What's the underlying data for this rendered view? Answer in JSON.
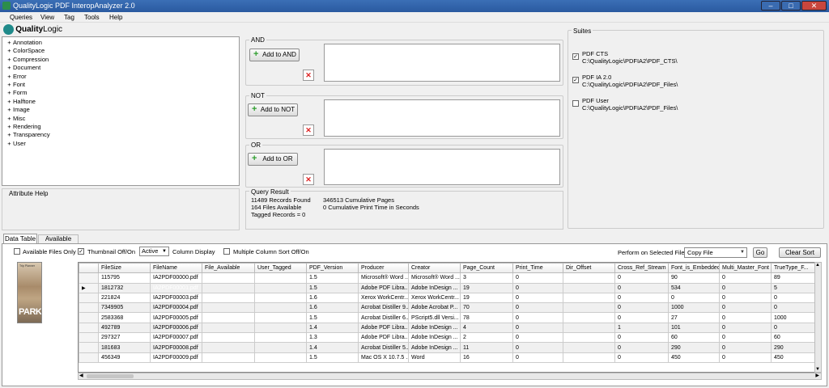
{
  "window": {
    "title": "QualityLogic PDF InteropAnalyzer 2.0",
    "min": "–",
    "max": "□",
    "close": "✕"
  },
  "menu": [
    "Queries",
    "View",
    "Tag",
    "Tools",
    "Help"
  ],
  "logo": {
    "text1": "Quality",
    "text2": "Logic"
  },
  "tree": [
    "Annotation",
    "ColorSpace",
    "Compression",
    "Document",
    "Error",
    "Font",
    "Form",
    "Halftone",
    "Image",
    "Misc",
    "Rendering",
    "Transparency",
    "User"
  ],
  "query": {
    "and": {
      "title": "AND",
      "button": "Add to AND"
    },
    "not": {
      "title": "NOT",
      "button": "Add to NOT"
    },
    "or": {
      "title": "OR",
      "button": "Add to OR"
    }
  },
  "suites": {
    "title": "Suites",
    "items": [
      {
        "name": "PDF CTS",
        "path": "C:\\QualityLogic\\PDFIA2\\PDF_CTS\\",
        "checked": true
      },
      {
        "name": "PDF IA 2.0",
        "path": "C:\\QualityLogic\\PDFIA2\\PDF_Files\\",
        "checked": true
      },
      {
        "name": "PDF User",
        "path": "C:\\QualityLogic\\PDFIA2\\PDF_Files\\",
        "checked": false
      }
    ]
  },
  "attribute_help": {
    "title": "Attribute Help"
  },
  "query_result": {
    "title": "Query Result",
    "records": "11489 Records Found",
    "files": "164 Files Available",
    "tagged": "Tagged Records = 0",
    "pages": "346513 Cumulative Pages",
    "print_time": "0 Cumulative Print Time in Seconds"
  },
  "tabs": [
    "Data Table",
    "Available Files"
  ],
  "toolbar": {
    "available_only": "Available Files Only",
    "thumbnail": "Thumbnail Off/On",
    "active": "Active",
    "column_display": "Column Display",
    "multi_sort": "Multiple Column Sort Off/On",
    "perform_label": "Perform on Selected File:",
    "action": "Copy File",
    "go": "Go",
    "clear_sort": "Clear Sort"
  },
  "thumb": {
    "small": "Trip Planner",
    "big": "PARK"
  },
  "table": {
    "columns": [
      "FileSize",
      "FileName",
      "File_Available",
      "User_Tagged",
      "PDF_Version",
      "Producer",
      "Creator",
      "Page_Count",
      "Print_Time",
      "Dir_Offset",
      "Cross_Ref_Stream",
      "Font_is_Embedded",
      "Multi_Master_Font",
      "TrueType_F..."
    ],
    "rows": [
      [
        "115795",
        "IA2PDF00000.pdf",
        "",
        "",
        "1.5",
        "Microsoft® Word ...",
        "Microsoft® Word ...",
        "3",
        "0",
        "",
        "0",
        "90",
        "0",
        "89"
      ],
      [
        "1812732",
        "IA2PDF00001.pdf",
        "",
        "",
        "1.5",
        "Adobe PDF Libra...",
        "Adobe InDesign ...",
        "19",
        "0",
        "",
        "0",
        "534",
        "0",
        "5"
      ],
      [
        "221824",
        "IA2PDF00003.pdf",
        "",
        "",
        "1.6",
        "Xerox WorkCentr...",
        "Xerox WorkCentr...",
        "19",
        "0",
        "",
        "0",
        "0",
        "0",
        "0"
      ],
      [
        "7349905",
        "IA2PDF00004.pdf",
        "",
        "",
        "1.6",
        "Acrobat Distiller 9...",
        "Adobe Acrobat P...",
        "70",
        "0",
        "",
        "0",
        "1000",
        "0",
        "0"
      ],
      [
        "2583368",
        "IA2PDF00005.pdf",
        "",
        "",
        "1.5",
        "Acrobat Distiller 6...",
        "PScript5.dll Versi...",
        "78",
        "0",
        "",
        "0",
        "27",
        "0",
        "1000"
      ],
      [
        "492789",
        "IA2PDF00006.pdf",
        "",
        "",
        "1.4",
        "Adobe PDF Libra...",
        "Adobe InDesign ...",
        "4",
        "0",
        "",
        "1",
        "101",
        "0",
        "0"
      ],
      [
        "297327",
        "IA2PDF00007.pdf",
        "",
        "",
        "1.3",
        "Adobe PDF Libra...",
        "Adobe InDesign ...",
        "2",
        "0",
        "",
        "0",
        "60",
        "0",
        "60"
      ],
      [
        "181683",
        "IA2PDF00008.pdf",
        "",
        "",
        "1.4",
        "Acrobat Distiller 5...",
        "Adobe InDesign ...",
        "11",
        "0",
        "",
        "0",
        "290",
        "0",
        "290"
      ],
      [
        "456349",
        "IA2PDF00009.pdf",
        "",
        "",
        "1.5",
        "Mac OS X 10.7.5 ...",
        "Word",
        "16",
        "0",
        "",
        "0",
        "450",
        "0",
        "450"
      ]
    ]
  }
}
